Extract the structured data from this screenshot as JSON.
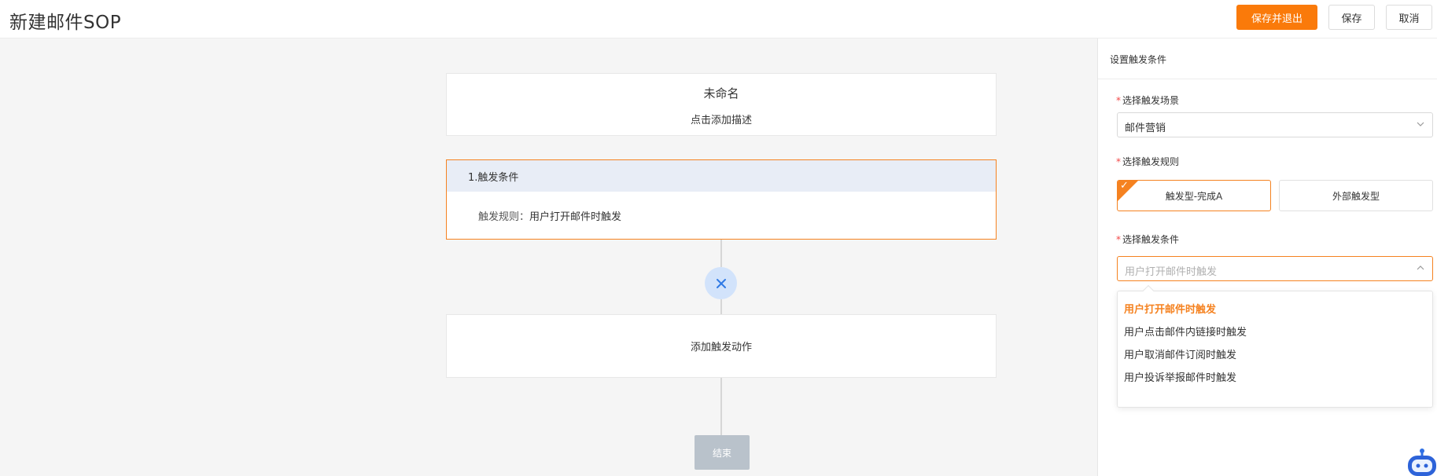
{
  "header": {
    "title": "新建邮件SOP",
    "save_exit_label": "保存并退出",
    "save_label": "保存",
    "cancel_label": "取消"
  },
  "canvas": {
    "title_card": {
      "name": "未命名",
      "description": "点击添加描述"
    },
    "trigger_card": {
      "heading": "1.触发条件",
      "rule_label": "触发规则：",
      "rule_value": "用户打开邮件时触发"
    },
    "remove_icon": "close-icon",
    "action_card": {
      "label": "添加触发动作"
    },
    "end_node": {
      "label": "结束"
    }
  },
  "panel": {
    "title": "设置触发条件",
    "required_mark": "*",
    "scene": {
      "label": "选择触发场景",
      "value": "邮件营销"
    },
    "rule": {
      "label": "选择触发规则",
      "options": [
        {
          "label": "触发型-完成A",
          "selected": true
        },
        {
          "label": "外部触发型",
          "selected": false
        }
      ]
    },
    "condition": {
      "label": "选择触发条件",
      "placeholder": "用户打开邮件时触发",
      "dropdown_open": true,
      "options": [
        {
          "label": "用户打开邮件时触发",
          "selected": true
        },
        {
          "label": "用户点击邮件内链接时触发",
          "selected": false
        },
        {
          "label": "用户取消邮件订阅时触发",
          "selected": false
        },
        {
          "label": "用户投诉举报邮件时触发",
          "selected": false
        }
      ]
    }
  },
  "colors": {
    "accent": "#f58220",
    "primary_button": "#fa7a0a",
    "canvas_bg": "#f5f5f5",
    "trigger_head_bg": "#e8edf6",
    "node_bg": "#d2e3fb",
    "end_node_bg": "#b9c2cb"
  }
}
